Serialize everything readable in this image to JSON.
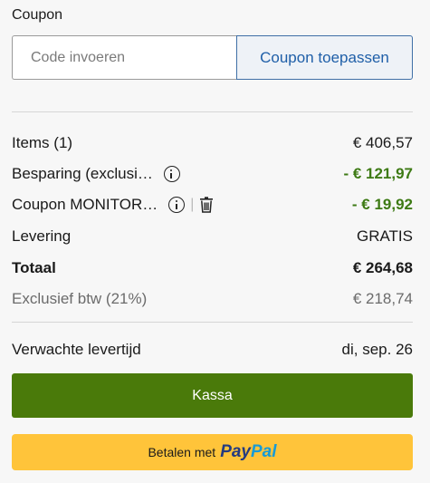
{
  "coupon": {
    "title": "Coupon",
    "placeholder": "Code invoeren",
    "value": "",
    "apply_label": "Coupon toepassen"
  },
  "summary": {
    "items_label": "Items (1)",
    "items_value": "€ 406,57",
    "savings_label": "Besparing (exclusi…",
    "savings_value": "- € 121,97",
    "coupon_label": "Coupon MONITOR…",
    "coupon_value": "- € 19,92",
    "delivery_label": "Levering",
    "delivery_value": "GRATIS",
    "total_label": "Totaal",
    "total_value": "€ 264,68",
    "excl_vat_label": "Exclusief btw (21%)",
    "excl_vat_value": "€ 218,74"
  },
  "delivery": {
    "label": "Verwachte levertijd",
    "value": "di, sep. 26"
  },
  "actions": {
    "checkout_label": "Kassa",
    "paypal_prefix": "Betalen met",
    "paypal_pay": "Pay",
    "paypal_pal": "Pal"
  },
  "icons": {
    "info": "info-icon",
    "trash": "trash-icon"
  },
  "colors": {
    "discount": "#3d7a14",
    "checkout_button": "#4a7a0a",
    "paypal_button": "#ffc43a",
    "apply_text": "#1f5fa8"
  }
}
